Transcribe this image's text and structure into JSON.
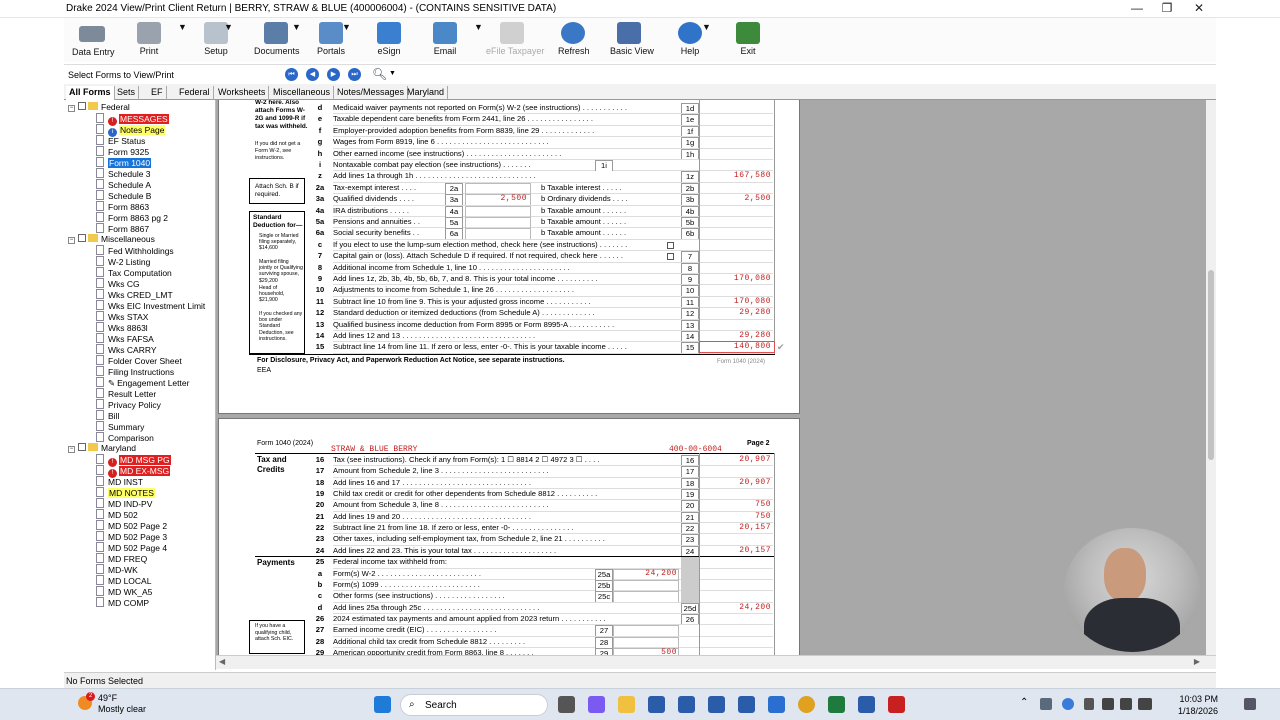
{
  "window": {
    "title": "Drake 2024 View/Print Client Return | BERRY, STRAW & BLUE (400006004) - (CONTAINS SENSITIVE DATA)",
    "minimize": "—",
    "restore": "❐",
    "close": "✕"
  },
  "toolbar": {
    "buttons": [
      {
        "label": "Data Entry"
      },
      {
        "label": "Print"
      },
      {
        "label": "Setup"
      },
      {
        "label": "Documents"
      },
      {
        "label": "Portals"
      },
      {
        "label": "eSign"
      },
      {
        "label": "Email"
      },
      {
        "label": "eFile Taxpayer"
      },
      {
        "label": "Refresh"
      },
      {
        "label": "Basic View"
      },
      {
        "label": "Help"
      },
      {
        "label": "Exit"
      }
    ]
  },
  "select_forms_label": "Select Forms to View/Print",
  "tabs": [
    "All Forms",
    "Sets",
    "EF",
    "Federal",
    "Worksheets",
    "Miscellaneous",
    "Notes/Messages",
    "Maryland"
  ],
  "tree": {
    "federal": "Federal",
    "federal_items": [
      "MESSAGES",
      "Notes Page",
      "EF Status",
      "Form 9325",
      "Form 1040",
      "Schedule 3",
      "Schedule A",
      "Schedule B",
      "Form 8863",
      "Form 8863 pg 2",
      "Form 8867"
    ],
    "misc": "Miscellaneous",
    "misc_items": [
      "Fed Withholdings",
      "W-2 Listing",
      "Tax Computation",
      "Wks CG",
      "Wks CRED_LMT",
      "Wks EIC Investment Limit",
      "Wks STAX",
      "Wks 8863l",
      "Wks FAFSA",
      "Wks CARRY",
      "Folder Cover Sheet",
      "Filing Instructions",
      "Engagement Letter",
      "Result Letter",
      "Privacy Policy",
      "Bill",
      "Summary",
      "Comparison"
    ],
    "maryland": "Maryland",
    "maryland_items": [
      "MD MSG PG",
      "MD EX-MSG",
      "MD INST",
      "MD NOTES",
      "MD IND-PV",
      "MD 502",
      "MD 502 Page 2",
      "MD 502 Page 3",
      "MD 502 Page 4",
      "MD FREQ",
      "MD-WK",
      "MD LOCAL",
      "MD WK_A5",
      "MD COMP"
    ]
  },
  "page1": {
    "side_w2": "W-2 here. Also attach Forms W-2G and 1099-R if tax was withheld.",
    "side_nogot": "If you did not get a Form W-2, see instructions.",
    "attach_b": "Attach Sch. B if required.",
    "std_title": "Standard Deduction for—",
    "std_items": [
      "Single or Married filing separately, $14,600",
      "Married filing jointly or Qualifying surviving spouse, $29,200",
      "Head of household, $21,900",
      "If you checked any box under Standard Deduction, see instructions."
    ],
    "lines": [
      {
        "n": "d",
        "t": "Medicaid waiver payments not reported on Form(s) W-2 (see instructions) . . . . . . . . . . .",
        "box": "1d",
        "amt": ""
      },
      {
        "n": "e",
        "t": "Taxable dependent care benefits from Form 2441, line 26 . . . . . . . . . . . . . . . .",
        "box": "1e",
        "amt": ""
      },
      {
        "n": "f",
        "t": "Employer-provided adoption benefits from Form 8839, line 29 . . . . . . . . . . . . .",
        "box": "1f",
        "amt": ""
      },
      {
        "n": "g",
        "t": "Wages from Form 8919, line 6 . . . . . . . . . . . . . . . . . . . . . . . . . . .",
        "box": "1g",
        "amt": ""
      },
      {
        "n": "h",
        "t": "Other earned income (see instructions) . . . . . . . . . . . . . . . . . . . . . . .",
        "box": "1h",
        "amt": ""
      },
      {
        "n": "i",
        "t": "Nontaxable combat pay election (see instructions) . . . . . . .",
        "box": "",
        "amt": ""
      },
      {
        "n": "z",
        "t": "Add lines 1a through 1h . . . . . . . . . . . . . . . . . . . . . . . . . . . . .",
        "box": "1z",
        "amt": "167,580"
      },
      {
        "n": "2a",
        "t": "Tax-exempt interest . . . .",
        "box": "2b",
        "amt": ""
      },
      {
        "n": "3a",
        "t": "Qualified dividends . . . .",
        "box": "3b",
        "amt": "2,500"
      },
      {
        "n": "4a",
        "t": "IRA distributions . . . . .",
        "box": "4b",
        "amt": ""
      },
      {
        "n": "5a",
        "t": "Pensions and annuities . .",
        "box": "5b",
        "amt": ""
      },
      {
        "n": "6a",
        "t": "Social security benefits . .",
        "box": "6b",
        "amt": ""
      },
      {
        "n": "c",
        "t": "If you elect to use the lump-sum election method, check here (see instructions) . . . . . . .",
        "box": "",
        "amt": ""
      },
      {
        "n": "7",
        "t": "Capital gain or (loss). Attach Schedule D if required. If not required, check here . . . . . .",
        "box": "7",
        "amt": ""
      },
      {
        "n": "8",
        "t": "Additional income from Schedule 1, line 10 . . . . . . . . . . . . . . . . . . . . . .",
        "box": "8",
        "amt": ""
      },
      {
        "n": "9",
        "t": "Add lines 1z, 2b, 3b, 4b, 5b, 6b, 7, and 8. This is your total income . . . . . . . . . .",
        "box": "9",
        "amt": "170,080"
      },
      {
        "n": "10",
        "t": "Adjustments to income from Schedule 1, line 26 . . . . . . . . . . . . . . . . . . .",
        "box": "10",
        "amt": ""
      },
      {
        "n": "11",
        "t": "Subtract line 10 from line 9. This is your adjusted gross income . . . . . . . . . . .",
        "box": "11",
        "amt": "170,080"
      },
      {
        "n": "12",
        "t": "Standard deduction or itemized deductions (from Schedule A) . . . . . . . . . . . . .",
        "box": "12",
        "amt": "29,280"
      },
      {
        "n": "13",
        "t": "Qualified business income deduction from Form 8995 or Form 8995-A . . . . . . . . . . .",
        "box": "13",
        "amt": ""
      },
      {
        "n": "14",
        "t": "Add lines 12 and 13 . . . . . . . . . . . . . . . . . . . . . . . . . . . . . . . .",
        "box": "14",
        "amt": "29,280"
      },
      {
        "n": "15",
        "t": "Subtract line 14 from line 11. If zero or less, enter -0-. This is your taxable income . . . . .",
        "box": "15",
        "amt": "140,800"
      }
    ],
    "i_box": "1i",
    "mid_2a": "2a",
    "mid_3a": "3a",
    "mid_4a": "4a",
    "mid_5a": "5a",
    "mid_6a": "6a",
    "mid_3a_amt": "2,500",
    "b_labels": [
      "b  Taxable interest . . . . .",
      "b  Ordinary dividends . . . .",
      "b  Taxable amount . . . . . .",
      "b  Taxable amount . . . . . .",
      "b  Taxable amount . . . . . ."
    ],
    "footer": "For Disclosure, Privacy Act, and Paperwork Reduction Act Notice, see separate instructions.",
    "footer2": "EEA",
    "form_tag": "Form 1040 (2024)"
  },
  "page2": {
    "form_label": "Form 1040 (2024)",
    "names": "STRAW & BLUE BERRY",
    "ssn": "400-00-6004",
    "page_label": "Page 2",
    "section_tax": "Tax and Credits",
    "section_pay": "Payments",
    "qual_note": "If you have a qualifying child, attach Sch. EIC.",
    "lines": [
      {
        "n": "16",
        "t": "Tax (see instructions). Check if any from Form(s):  1 ☐ 8814   2 ☐ 4972   3 ☐ . . . .",
        "box": "16",
        "amt": "20,907"
      },
      {
        "n": "17",
        "t": "Amount from Schedule 2, line 3 . . . . . . . . . . . . . . . . . . . . . . . . . .",
        "box": "17",
        "amt": ""
      },
      {
        "n": "18",
        "t": "Add lines 16 and 17 . . . . . . . . . . . . . . . . . . . . . . . . . . . . . . .",
        "box": "18",
        "amt": "20,907"
      },
      {
        "n": "19",
        "t": "Child tax credit or credit for other dependents from Schedule 8812 . . . . . . . . . .",
        "box": "19",
        "amt": ""
      },
      {
        "n": "20",
        "t": "Amount from Schedule 3, line 8 . . . . . . . . . . . . . . . . . . . . . . . . . .",
        "box": "20",
        "amt": "750"
      },
      {
        "n": "21",
        "t": "Add lines 19 and 20 . . . . . . . . . . . . . . . . . . . . . . . . . . . . . . .",
        "box": "21",
        "amt": "750"
      },
      {
        "n": "22",
        "t": "Subtract line 21 from line 18. If zero or less, enter -0- . . . . . . . . . . . . . . .",
        "box": "22",
        "amt": "20,157"
      },
      {
        "n": "23",
        "t": "Other taxes, including self-employment tax, from Schedule 2, line 21 . . . . . . . . . .",
        "box": "23",
        "amt": ""
      },
      {
        "n": "24",
        "t": "Add lines 22 and 23. This is your total tax . . . . . . . . . . . . . . . . . . . .",
        "box": "24",
        "amt": "20,157"
      },
      {
        "n": "25",
        "t": "Federal income tax withheld from:",
        "box": "",
        "amt": ""
      },
      {
        "n": "a",
        "t": "Form(s) W-2 . . . . . . . . . . . . . . . . . . . . . . . . .",
        "box": "",
        "amt": ""
      },
      {
        "n": "b",
        "t": "Form(s) 1099 . . . . . . . . . . . . . . . . . . . . . . . .",
        "box": "",
        "amt": ""
      },
      {
        "n": "c",
        "t": "Other forms (see instructions) . . . . . . . . . . . . . . . . .",
        "box": "",
        "amt": ""
      },
      {
        "n": "d",
        "t": "Add lines 25a through 25c . . . . . . . . . . . . . . . . . . . . . . . . . . . .",
        "box": "25d",
        "amt": "24,200"
      },
      {
        "n": "26",
        "t": "2024 estimated tax payments and amount applied from 2023 return . . . . . . . . . . .",
        "box": "26",
        "amt": ""
      },
      {
        "n": "27",
        "t": "Earned income credit (EIC) . . . . . . . . . . . . . . . . .",
        "box": "",
        "amt": ""
      },
      {
        "n": "28",
        "t": "Additional child tax credit from Schedule 8812 . . . . . . . . .",
        "box": "",
        "amt": ""
      },
      {
        "n": "29",
        "t": "American opportunity credit from Form 8863, line 8 . . . . . . .",
        "box": "",
        "amt": ""
      }
    ],
    "sub": [
      {
        "box": "25a",
        "amt": "24,200"
      },
      {
        "box": "25b",
        "amt": ""
      },
      {
        "box": "25c",
        "amt": ""
      },
      {
        "box": "27",
        "amt": ""
      },
      {
        "box": "28",
        "amt": ""
      },
      {
        "box": "29",
        "amt": "500"
      }
    ]
  },
  "status": "No Forms Selected",
  "taskbar": {
    "temp": "49°F",
    "weather": "Mostly clear",
    "search": "Search",
    "time": "10:03 PM",
    "date": "1/18/2026",
    "badge": "2"
  }
}
